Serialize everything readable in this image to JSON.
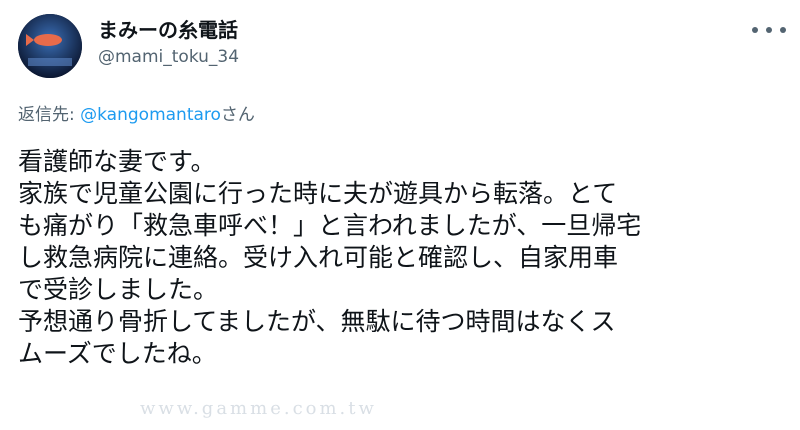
{
  "tweet": {
    "display_name": "まみーの糸電話",
    "handle": "@mami_toku_34",
    "reply_prefix": "返信先: ",
    "reply_to": "@kangomantaro",
    "reply_suffix": "さん",
    "lines": [
      "看護師な妻です。",
      "家族で児童公園に行った時に夫が遊具から転落。とて",
      "も痛がり「救急車呼べ！」と言われましたが、一旦帰宅",
      "し救急病院に連絡。受け入れ可能と確認し、自家用車",
      "で受診しました。",
      "予想通り骨折してましたが、無駄に待つ時間はなくス",
      "ムーズでしたね。"
    ],
    "more_icon": "more-horizontal-icon"
  },
  "watermark": "www.gamme.com.tw"
}
